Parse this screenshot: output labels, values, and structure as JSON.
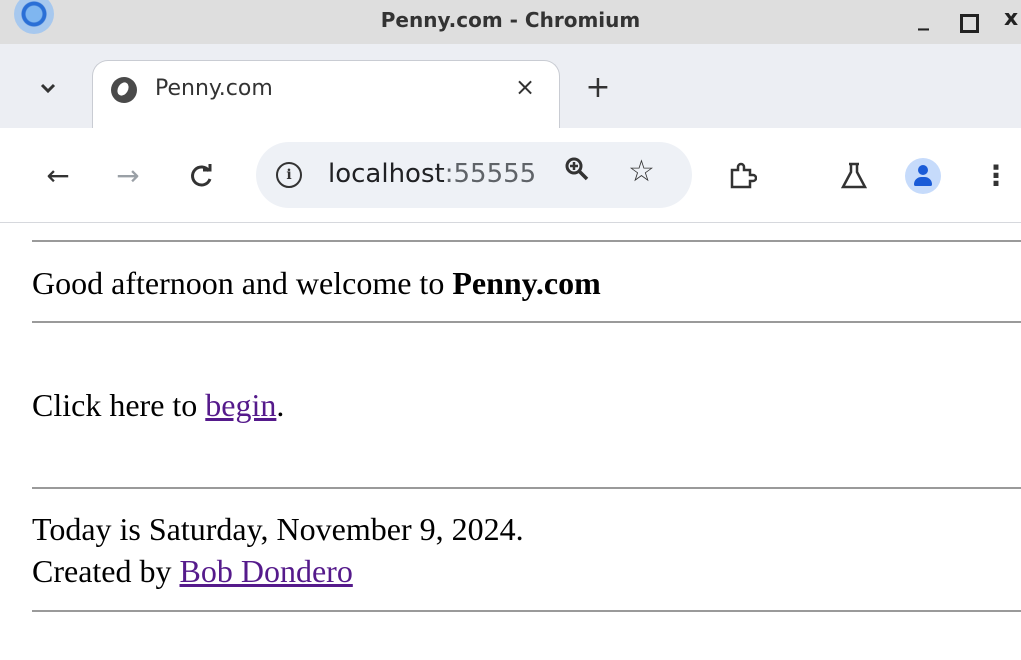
{
  "window": {
    "title": "Penny.com - Chromium",
    "controls": {
      "minimize": "_",
      "maximize": "",
      "close": "x"
    }
  },
  "tabs": [
    {
      "title": "Penny.com",
      "active": true
    }
  ],
  "tabstrip": {
    "tab_search_icon": "chevron-down",
    "close_icon": "×",
    "new_tab_icon": "+"
  },
  "toolbar": {
    "back_icon": "←",
    "forward_icon": "→",
    "reload_icon": "C",
    "site_info_icon": "i",
    "url_host": "localhost",
    "url_port": ":55555",
    "zoom_icon": "🔍",
    "bookmark_icon": "☆",
    "extensions_icon": "puzzle",
    "labs_icon": "flask",
    "menu_icon": "⋮"
  },
  "page": {
    "greeting_prefix": "Good afternoon and welcome to ",
    "greeting_site": "Penny.com",
    "begin_prefix": "Click here to ",
    "begin_link": "begin",
    "begin_suffix": ".",
    "date_text": "Today is Saturday, November 9, 2024.",
    "created_prefix": "Created by ",
    "created_link": "Bob Dondero"
  },
  "colors": {
    "link_visited": "#551a8b",
    "titlebar": "#dedede",
    "tabstrip": "#eceef3",
    "omnibox": "#eef1f6",
    "profile_accent": "#1a5bd7"
  }
}
